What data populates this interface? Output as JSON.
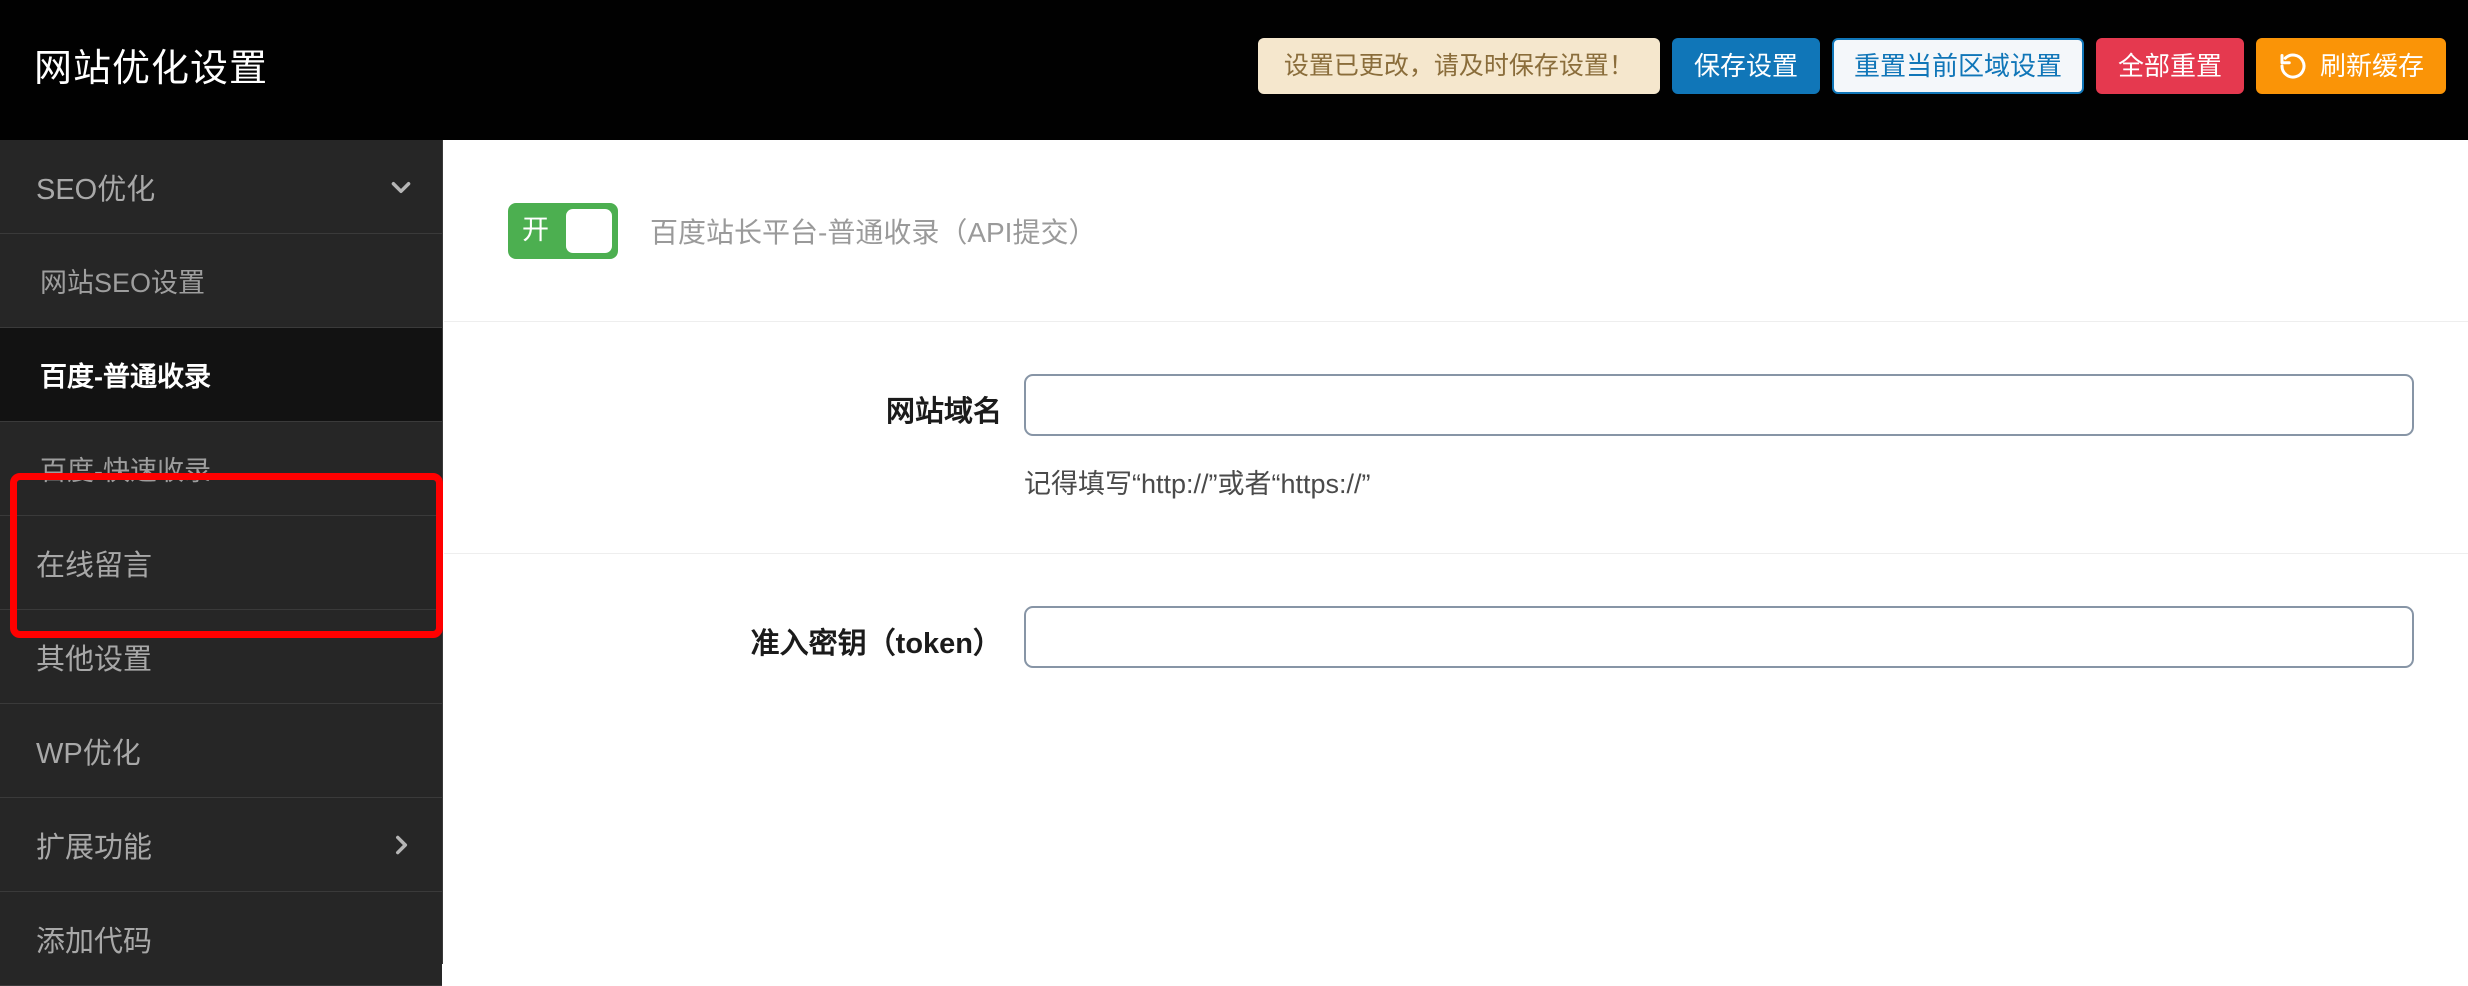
{
  "header": {
    "title": "网站优化设置",
    "notice": "设置已更改，请及时保存设置！",
    "save_label": "保存设置",
    "reset_section_label": "重置当前区域设置",
    "reset_all_label": "全部重置",
    "refresh_cache_label": "刷新缓存",
    "refresh_icon": "refresh-ccw-icon",
    "colors": {
      "bar_bg": "#010101",
      "notice_bg": "#f5e7cd",
      "notice_text": "#8a6d3b",
      "primary": "#1076b8",
      "ghost_bg": "#f4f7fa",
      "danger": "#e5394f",
      "warning": "#fa9407"
    }
  },
  "sidebar": {
    "bg": "#262626",
    "items": [
      {
        "label": "SEO优化",
        "type": "group",
        "icon": "chevron-down-icon",
        "active": false
      },
      {
        "label": "网站SEO设置",
        "type": "sub",
        "icon": "",
        "active": false
      },
      {
        "label": "百度-普通收录",
        "type": "sub",
        "icon": "",
        "active": true
      },
      {
        "label": "百度-快速收录",
        "type": "sub",
        "icon": "",
        "active": false
      },
      {
        "label": "在线留言",
        "type": "group",
        "icon": "",
        "active": false
      },
      {
        "label": "其他设置",
        "type": "group",
        "icon": "",
        "active": false
      },
      {
        "label": "WP优化",
        "type": "group",
        "icon": "",
        "active": false
      },
      {
        "label": "扩展功能",
        "type": "group",
        "icon": "chevron-right-icon",
        "active": false
      },
      {
        "label": "添加代码",
        "type": "group",
        "icon": "",
        "active": false
      }
    ],
    "annotation": {
      "color": "#ff0000",
      "covers": [
        "百度-普通收录",
        "百度-快速收录"
      ]
    }
  },
  "main": {
    "toggle": {
      "state_label": "开",
      "on": true,
      "color": "#4caf50",
      "caption": "百度站长平台-普通收录（API提交）"
    },
    "fields": [
      {
        "label": "网站域名",
        "value": "",
        "placeholder": "",
        "help": "记得填写“http://”或者“https://”"
      },
      {
        "label": "准入密钥（token）",
        "value": "",
        "placeholder": "",
        "help": ""
      }
    ]
  }
}
